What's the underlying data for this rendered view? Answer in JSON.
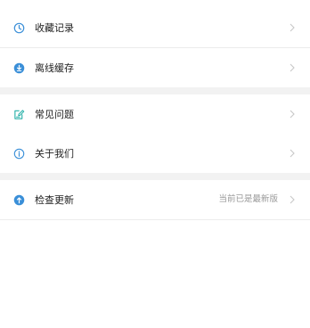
{
  "menu": {
    "group1": [
      {
        "label": "收藏记录",
        "icon": "clock-icon"
      },
      {
        "label": "离线缓存",
        "icon": "download-circle-icon"
      }
    ],
    "group2": [
      {
        "label": "常见问题",
        "icon": "edit-document-icon"
      },
      {
        "label": "关于我们",
        "icon": "info-circle-icon"
      }
    ],
    "group3": [
      {
        "label": "检查更新",
        "icon": "upload-circle-icon",
        "status": "当前已是最新版"
      }
    ]
  },
  "colors": {
    "accent": "#3a8fd8",
    "teal": "#27b0a8",
    "text": "#222222",
    "subtext": "#9a9a9a",
    "separator": "#f2f2f2"
  }
}
